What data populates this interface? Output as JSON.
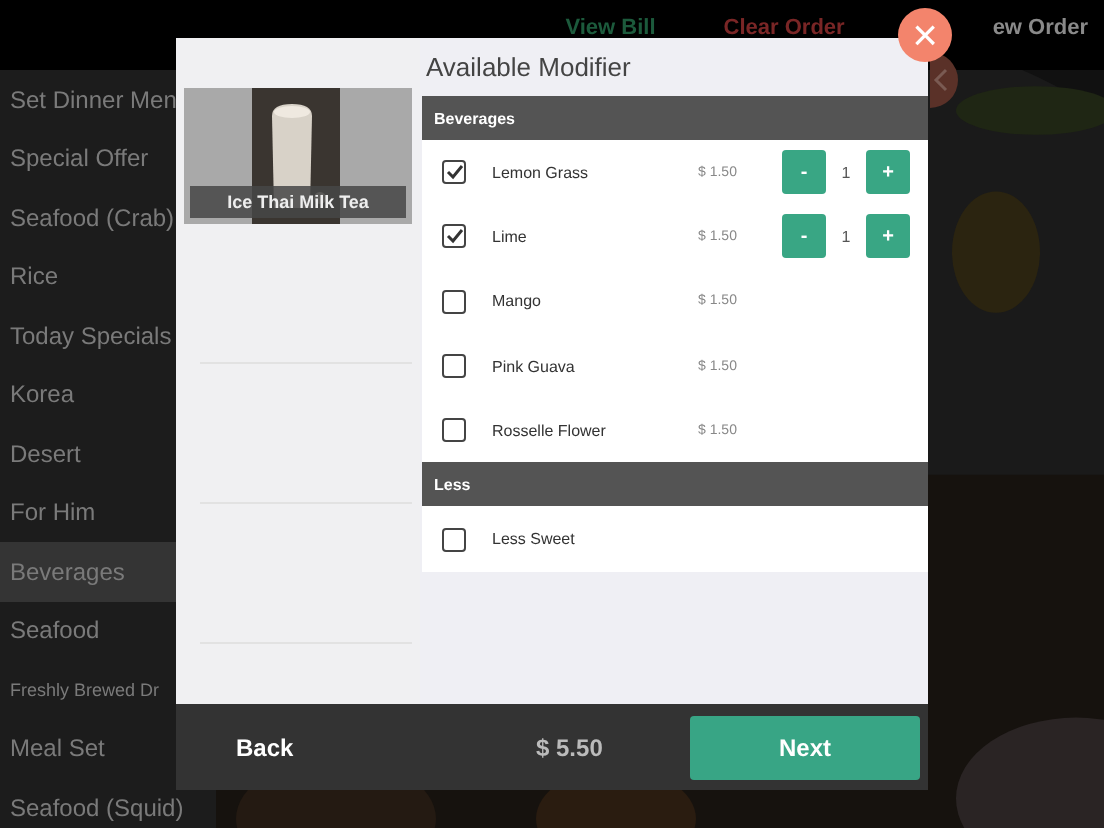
{
  "header": {
    "links": [
      {
        "label": "View Bill",
        "color": "#1c5a3c"
      },
      {
        "label": "Clear Order",
        "color": "#7a2626"
      },
      {
        "label": "ew Order",
        "color": "#8a8a8a"
      }
    ]
  },
  "categories": [
    {
      "label": "Set Dinner Men",
      "selected": false
    },
    {
      "label": "Special Offer",
      "selected": false
    },
    {
      "label": "Seafood (Crab)",
      "selected": false
    },
    {
      "label": "Rice",
      "selected": false
    },
    {
      "label": "Today Specials",
      "selected": false
    },
    {
      "label": "Korea",
      "selected": false
    },
    {
      "label": "Desert",
      "selected": false
    },
    {
      "label": "For Him",
      "selected": false
    },
    {
      "label": "Beverages",
      "selected": true
    },
    {
      "label": "Seafood",
      "selected": false
    },
    {
      "label": "Freshly Brewed Dr",
      "selected": false,
      "small": true
    },
    {
      "label": "Meal Set",
      "selected": false
    },
    {
      "label": "Seafood (Squid)",
      "selected": false
    }
  ],
  "modal": {
    "item": {
      "name": "Ice Thai Milk Tea",
      "kind": "picture"
    },
    "title": "Available Modifier",
    "groups": [
      {
        "name": "Beverages",
        "options": [
          {
            "name": "Lemon Grass",
            "price": "$ 1.50",
            "checked": true,
            "quantity": "1",
            "minus": "-",
            "plus": "+"
          },
          {
            "name": "Lime",
            "price": "$ 1.50",
            "checked": true,
            "quantity": "1",
            "minus": "-",
            "plus": "+"
          },
          {
            "name": "Mango",
            "price": "$ 1.50",
            "checked": false
          },
          {
            "name": "Pink Guava",
            "price": "$ 1.50",
            "checked": false
          },
          {
            "name": "Rosselle Flower",
            "price": "$ 1.50",
            "checked": false
          }
        ]
      },
      {
        "name": "Less",
        "options": [
          {
            "name": "Less Sweet",
            "checked": false
          }
        ]
      }
    ],
    "back": "Back",
    "total": "$ 5.50",
    "next": "Next",
    "close": "×"
  }
}
